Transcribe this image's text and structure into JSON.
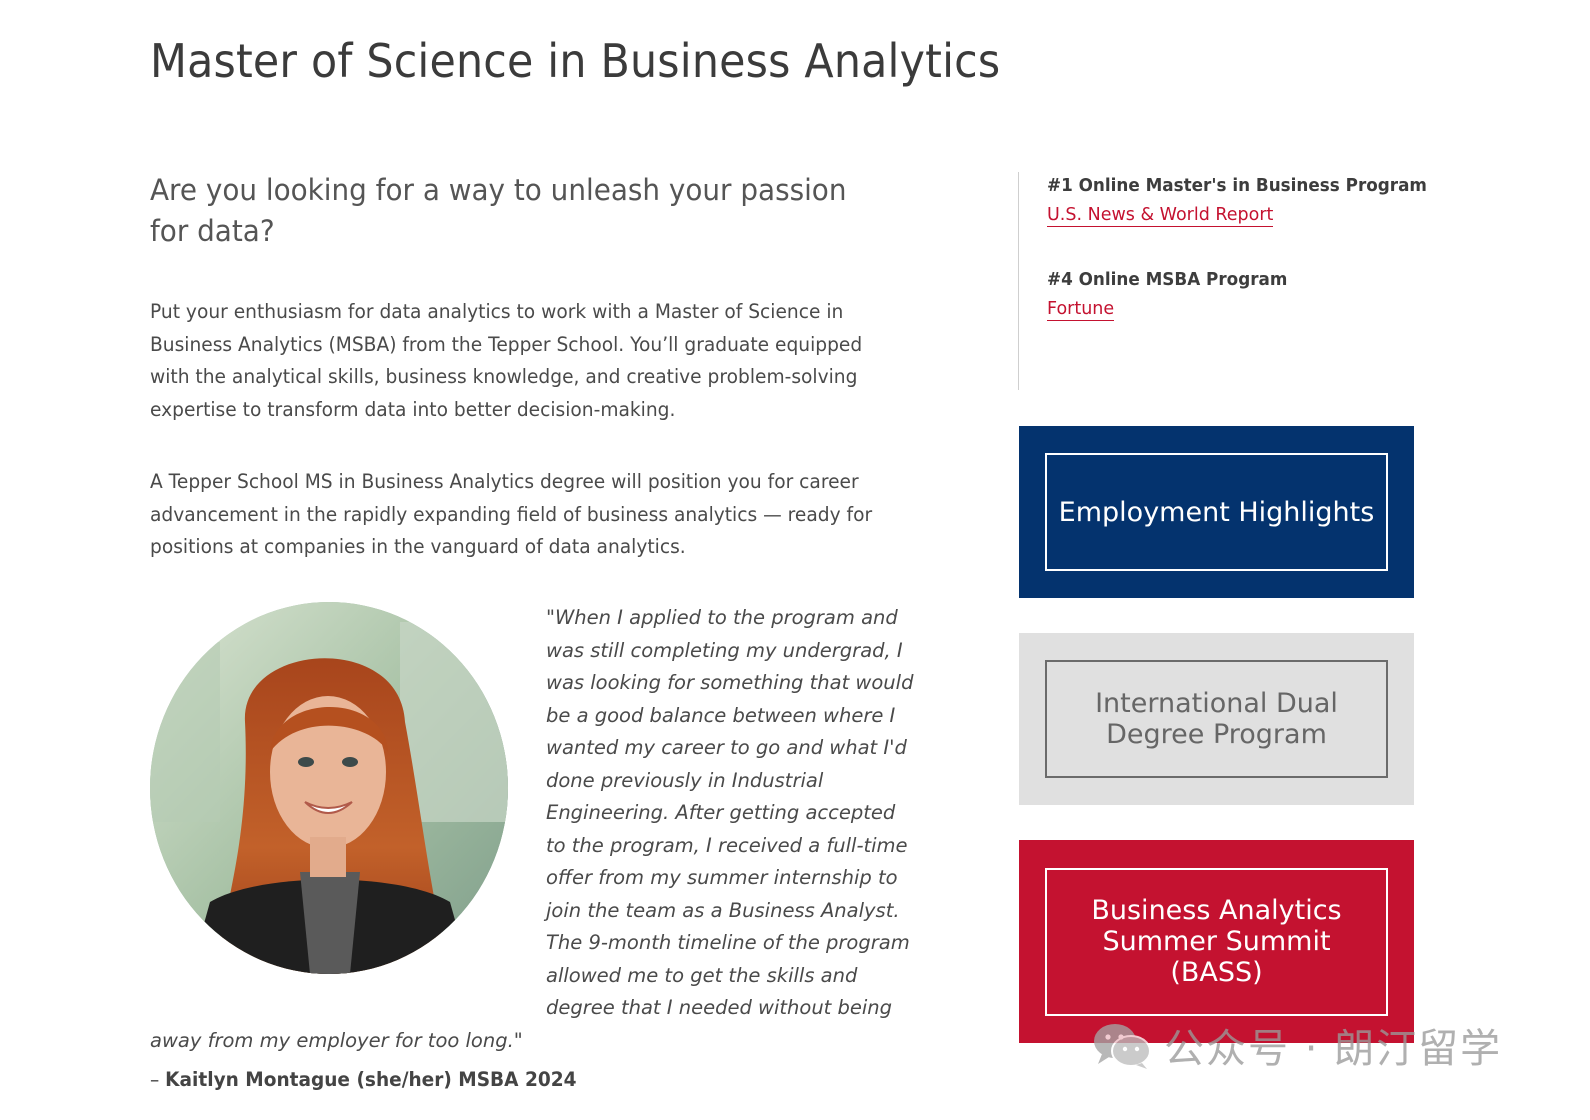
{
  "header": {
    "title": "Master of Science in Business Analytics"
  },
  "main": {
    "lead": "Are you looking for a way to unleash your passion for data?",
    "paragraph_1": "Put your enthusiasm for data analytics to work with a Master of Science in Business Analytics (MSBA) from the Tepper School. You’ll graduate equipped with the analytical skills, business knowledge, and creative problem-solving expertise to transform data into better decision-making.",
    "paragraph_2": "A Tepper School MS in Business Analytics degree will position you for career advancement in the rapidly expanding field of business analytics — ready for positions at companies in the vanguard of data analytics.",
    "testimonial": {
      "quote": "\"When I applied to the program and was still completing my undergrad, I was looking for something that would be a good balance between where I wanted my career to go and what I'd done previously in Industrial Engineering. After getting accepted to the program, I received a full-time offer from my summer internship to join the team as a Business Analyst. The 9-month timeline of the program allowed me to get the skills and degree that I needed without being away from my employer for too long.\"",
      "dash": "– ",
      "author": "Kaitlyn Montague (she/her) MSBA 2024"
    }
  },
  "sidebar": {
    "rankings": [
      {
        "title": "#1 Online Master's in Business Program",
        "source": "U.S. News & World Report"
      },
      {
        "title": "#4 Online MSBA Program",
        "source": "Fortune"
      }
    ],
    "ctas": [
      {
        "label": "Employment Highlights",
        "color": "#04336e"
      },
      {
        "label": "International Dual Degree Program",
        "color": "#e0e0e0"
      },
      {
        "label": "Business Analytics Summer Summit (BASS)",
        "color": "#c41230"
      }
    ]
  },
  "watermark": {
    "icon": "wechat-icon",
    "text": "公众号 · 朗汀留学"
  },
  "colors": {
    "accent_red": "#c41230",
    "navy": "#04336e",
    "text": "#4a4a4a"
  }
}
